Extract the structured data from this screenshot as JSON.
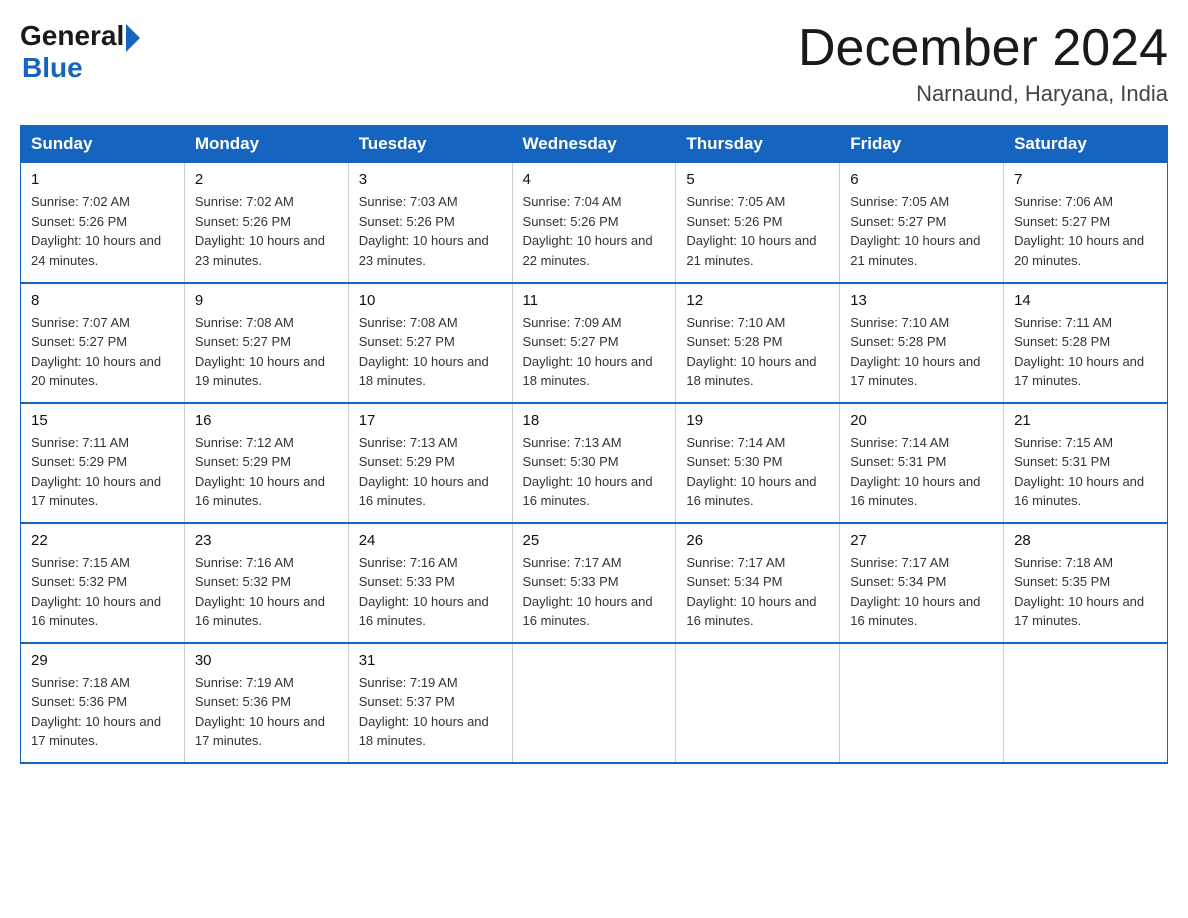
{
  "header": {
    "logo_general": "General",
    "logo_blue": "Blue",
    "month_title": "December 2024",
    "location": "Narnaund, Haryana, India"
  },
  "weekdays": [
    "Sunday",
    "Monday",
    "Tuesday",
    "Wednesday",
    "Thursday",
    "Friday",
    "Saturday"
  ],
  "weeks": [
    [
      {
        "day": "1",
        "sunrise": "7:02 AM",
        "sunset": "5:26 PM",
        "daylight": "10 hours and 24 minutes."
      },
      {
        "day": "2",
        "sunrise": "7:02 AM",
        "sunset": "5:26 PM",
        "daylight": "10 hours and 23 minutes."
      },
      {
        "day": "3",
        "sunrise": "7:03 AM",
        "sunset": "5:26 PM",
        "daylight": "10 hours and 23 minutes."
      },
      {
        "day": "4",
        "sunrise": "7:04 AM",
        "sunset": "5:26 PM",
        "daylight": "10 hours and 22 minutes."
      },
      {
        "day": "5",
        "sunrise": "7:05 AM",
        "sunset": "5:26 PM",
        "daylight": "10 hours and 21 minutes."
      },
      {
        "day": "6",
        "sunrise": "7:05 AM",
        "sunset": "5:27 PM",
        "daylight": "10 hours and 21 minutes."
      },
      {
        "day": "7",
        "sunrise": "7:06 AM",
        "sunset": "5:27 PM",
        "daylight": "10 hours and 20 minutes."
      }
    ],
    [
      {
        "day": "8",
        "sunrise": "7:07 AM",
        "sunset": "5:27 PM",
        "daylight": "10 hours and 20 minutes."
      },
      {
        "day": "9",
        "sunrise": "7:08 AM",
        "sunset": "5:27 PM",
        "daylight": "10 hours and 19 minutes."
      },
      {
        "day": "10",
        "sunrise": "7:08 AM",
        "sunset": "5:27 PM",
        "daylight": "10 hours and 18 minutes."
      },
      {
        "day": "11",
        "sunrise": "7:09 AM",
        "sunset": "5:27 PM",
        "daylight": "10 hours and 18 minutes."
      },
      {
        "day": "12",
        "sunrise": "7:10 AM",
        "sunset": "5:28 PM",
        "daylight": "10 hours and 18 minutes."
      },
      {
        "day": "13",
        "sunrise": "7:10 AM",
        "sunset": "5:28 PM",
        "daylight": "10 hours and 17 minutes."
      },
      {
        "day": "14",
        "sunrise": "7:11 AM",
        "sunset": "5:28 PM",
        "daylight": "10 hours and 17 minutes."
      }
    ],
    [
      {
        "day": "15",
        "sunrise": "7:11 AM",
        "sunset": "5:29 PM",
        "daylight": "10 hours and 17 minutes."
      },
      {
        "day": "16",
        "sunrise": "7:12 AM",
        "sunset": "5:29 PM",
        "daylight": "10 hours and 16 minutes."
      },
      {
        "day": "17",
        "sunrise": "7:13 AM",
        "sunset": "5:29 PM",
        "daylight": "10 hours and 16 minutes."
      },
      {
        "day": "18",
        "sunrise": "7:13 AM",
        "sunset": "5:30 PM",
        "daylight": "10 hours and 16 minutes."
      },
      {
        "day": "19",
        "sunrise": "7:14 AM",
        "sunset": "5:30 PM",
        "daylight": "10 hours and 16 minutes."
      },
      {
        "day": "20",
        "sunrise": "7:14 AM",
        "sunset": "5:31 PM",
        "daylight": "10 hours and 16 minutes."
      },
      {
        "day": "21",
        "sunrise": "7:15 AM",
        "sunset": "5:31 PM",
        "daylight": "10 hours and 16 minutes."
      }
    ],
    [
      {
        "day": "22",
        "sunrise": "7:15 AM",
        "sunset": "5:32 PM",
        "daylight": "10 hours and 16 minutes."
      },
      {
        "day": "23",
        "sunrise": "7:16 AM",
        "sunset": "5:32 PM",
        "daylight": "10 hours and 16 minutes."
      },
      {
        "day": "24",
        "sunrise": "7:16 AM",
        "sunset": "5:33 PM",
        "daylight": "10 hours and 16 minutes."
      },
      {
        "day": "25",
        "sunrise": "7:17 AM",
        "sunset": "5:33 PM",
        "daylight": "10 hours and 16 minutes."
      },
      {
        "day": "26",
        "sunrise": "7:17 AM",
        "sunset": "5:34 PM",
        "daylight": "10 hours and 16 minutes."
      },
      {
        "day": "27",
        "sunrise": "7:17 AM",
        "sunset": "5:34 PM",
        "daylight": "10 hours and 16 minutes."
      },
      {
        "day": "28",
        "sunrise": "7:18 AM",
        "sunset": "5:35 PM",
        "daylight": "10 hours and 17 minutes."
      }
    ],
    [
      {
        "day": "29",
        "sunrise": "7:18 AM",
        "sunset": "5:36 PM",
        "daylight": "10 hours and 17 minutes."
      },
      {
        "day": "30",
        "sunrise": "7:19 AM",
        "sunset": "5:36 PM",
        "daylight": "10 hours and 17 minutes."
      },
      {
        "day": "31",
        "sunrise": "7:19 AM",
        "sunset": "5:37 PM",
        "daylight": "10 hours and 18 minutes."
      },
      null,
      null,
      null,
      null
    ]
  ]
}
